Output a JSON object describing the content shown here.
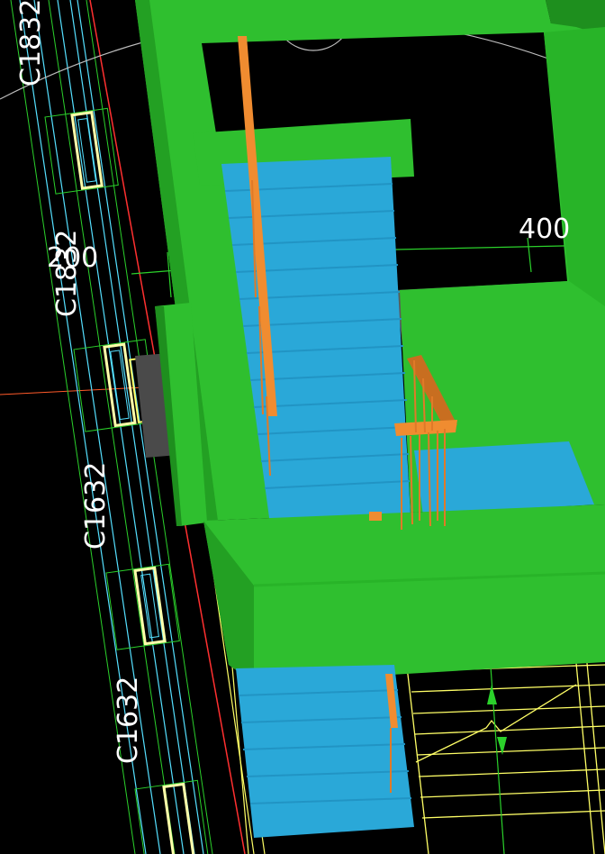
{
  "viewport": {
    "background": "#000000",
    "accent_colors": {
      "slab": "#2fbf2f",
      "slab_shadow": "#1e8f1e",
      "stair": "#2aa8d8",
      "stair_dark": "#1f8fbf",
      "rail": "#f08c30",
      "gray_floor": "#5a5a5a",
      "cad_yellow": "#ffff66",
      "cad_cyan": "#55e0ff",
      "cad_red": "#ff3030",
      "cad_green": "#2bd12b"
    }
  },
  "labels": {
    "window_tag_1": "C1832",
    "window_tag_2": "C1832",
    "window_tag_3": "C1632",
    "window_tag_4": "C1632",
    "dimension_400": "400",
    "dimension_200": "200"
  }
}
